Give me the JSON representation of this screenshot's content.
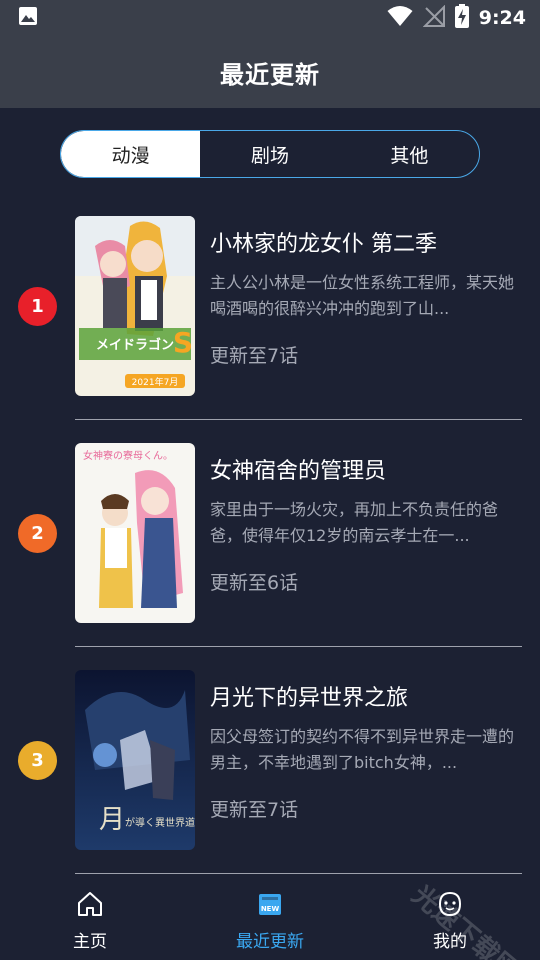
{
  "status_bar": {
    "time": "9:24",
    "icons": [
      "image-icon",
      "wifi-icon",
      "no-signal-icon",
      "battery-charging-icon"
    ]
  },
  "header": {
    "title": "最近更新"
  },
  "tabs": [
    {
      "label": "动漫",
      "active": true
    },
    {
      "label": "剧场",
      "active": false
    },
    {
      "label": "其他",
      "active": false
    }
  ],
  "items": [
    {
      "rank": "1",
      "rank_color": "#e8202a",
      "title": "小林家的龙女仆 第二季",
      "description": "主人公小林是一位女性系统工程师，某天她喝酒喝的很醉兴冲冲的跑到了山...",
      "update": "更新至7话",
      "cover": {
        "logo_text": "小林さんちのメイドラゴンS",
        "date_text": "2021年7月"
      }
    },
    {
      "rank": "2",
      "rank_color": "#f06a28",
      "title": "女神宿舍的管理员",
      "description": "家里由于一场火灾，再加上不负责任的爸爸，使得年仅12岁的南云孝士在一...",
      "update": "更新至6话",
      "cover": {
        "logo_text": "女神寮の寮母くん。"
      }
    },
    {
      "rank": "3",
      "rank_color": "#e9ac2c",
      "title": "月光下的异世界之旅",
      "description": "因父母签订的契约不得不到异世界走一遭的男主，不幸地遇到了bitch女神，...",
      "update": "更新至7话",
      "cover": {
        "logo_text": "月が導く異世界道中"
      }
    }
  ],
  "bottom_nav": [
    {
      "label": "主页",
      "icon": "home-icon",
      "active": false
    },
    {
      "label": "最近更新",
      "icon": "new-badge-icon",
      "active": true,
      "badge_text": "NEW"
    },
    {
      "label": "我的",
      "icon": "profile-face-icon",
      "active": false
    }
  ],
  "colors": {
    "background": "#1c2133",
    "header": "#3a3f4a",
    "accent": "#3aa7f0",
    "muted_text": "#a5a9b5"
  },
  "watermark": "光速下载网"
}
